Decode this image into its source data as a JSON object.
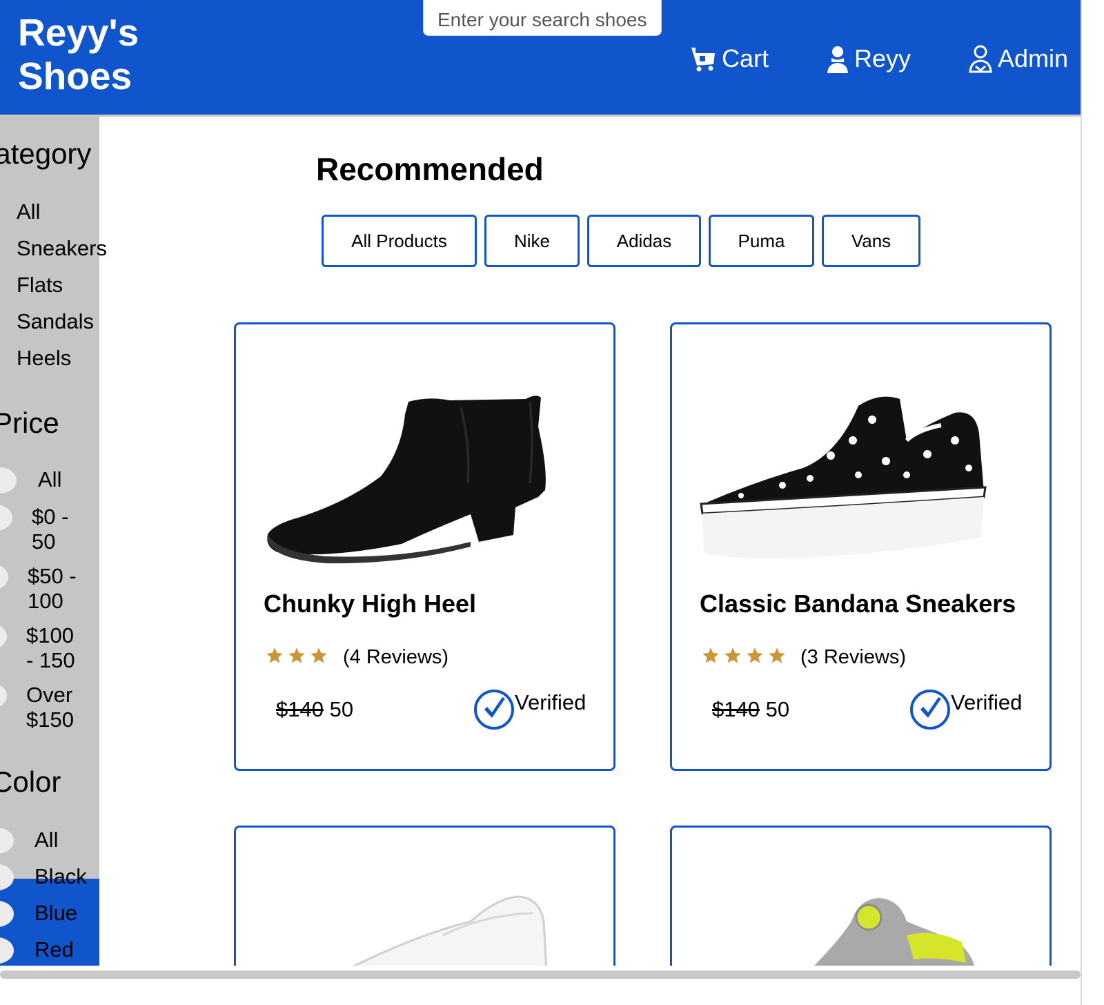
{
  "header": {
    "brand_line1": "Reyy's",
    "brand_line2": "Shoes",
    "search_placeholder": "Enter your search shoes",
    "nav": {
      "cart": "Cart",
      "user": "Reyy",
      "admin": "Admin"
    }
  },
  "sidebar": {
    "category_heading": "Category",
    "categories": [
      "All",
      "Sneakers",
      "Flats",
      "Sandals",
      "Heels"
    ],
    "price_heading": "Price",
    "prices": [
      {
        "line1": "All",
        "line2": ""
      },
      {
        "line1": "$0 -",
        "line2": "50"
      },
      {
        "line1": "$50 -",
        "line2": "100"
      },
      {
        "line1": "$100",
        "line2": "- 150"
      },
      {
        "line1": "Over",
        "line2": "$150"
      }
    ],
    "color_heading": "Color",
    "colors": [
      "All",
      "Black",
      "Blue",
      "Red"
    ]
  },
  "main": {
    "title": "Recommended",
    "filters": [
      "All Products",
      "Nike",
      "Adidas",
      "Puma",
      "Vans"
    ],
    "products": [
      {
        "name": "Chunky High Heel",
        "stars": 3,
        "reviews": "(4 Reviews)",
        "old_price": "$140",
        "price": "50",
        "badge": "Verified",
        "image_icon": "black-ankle-boot"
      },
      {
        "name": "Classic Bandana Sneakers",
        "stars": 4,
        "reviews": "(3 Reviews)",
        "old_price": "$140",
        "price": "50",
        "badge": "Verified",
        "image_icon": "bandana-slip-on-sneaker"
      },
      {
        "name": "",
        "image_icon": "white-slip-on-shoe"
      },
      {
        "name": "",
        "image_icon": "grey-yellow-running-shoe"
      }
    ]
  },
  "colors": {
    "brand_blue": "#1155cc",
    "sidebar_grey": "#c5c5c5",
    "star_gold": "#c9963a"
  }
}
